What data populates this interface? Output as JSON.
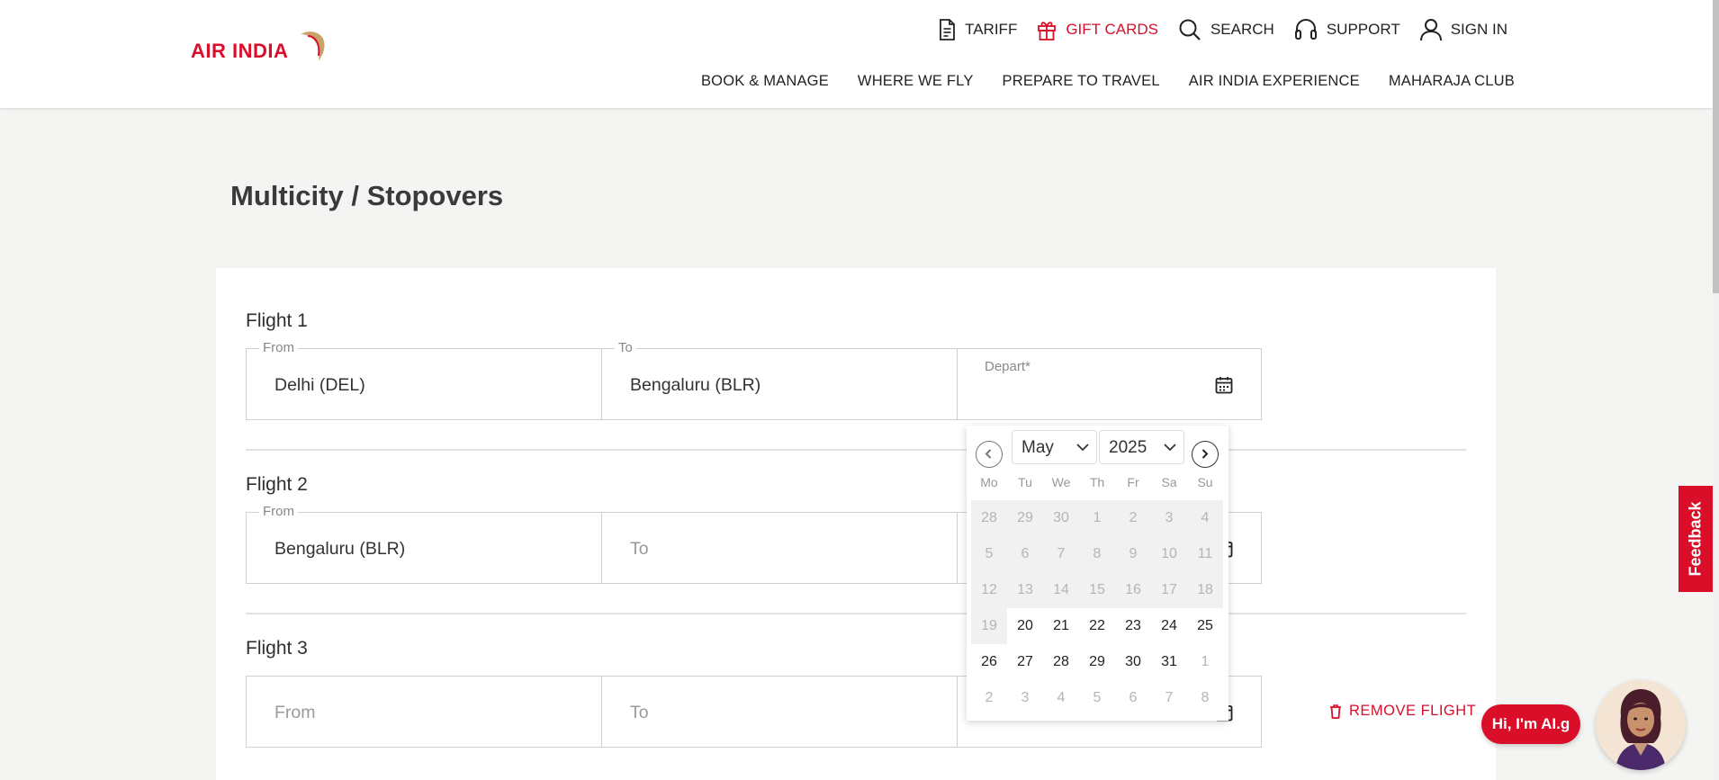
{
  "brand": {
    "logo_text": "AIR INDIA",
    "accent_color": "#da0e29"
  },
  "utility_nav": [
    {
      "label": "TARIFF",
      "icon": "document-icon"
    },
    {
      "label": "GIFT CARDS",
      "icon": "gift-icon"
    },
    {
      "label": "SEARCH",
      "icon": "search-icon"
    },
    {
      "label": "SUPPORT",
      "icon": "headset-icon"
    },
    {
      "label": "SIGN IN",
      "icon": "user-icon"
    }
  ],
  "main_nav": [
    "BOOK & MANAGE",
    "WHERE WE FLY",
    "PREPARE TO TRAVEL",
    "AIR INDIA EXPERIENCE",
    "MAHARAJA CLUB"
  ],
  "page_title": "Multicity / Stopovers",
  "flights": [
    {
      "label": "Flight 1",
      "from_legend": "From",
      "from_value": "Delhi (DEL)",
      "to_legend": "To",
      "to_value": "Bengaluru (BLR)",
      "depart_label": "Depart*"
    },
    {
      "label": "Flight 2",
      "from_legend": "From",
      "from_value": "Bengaluru (BLR)",
      "to_placeholder": "To"
    },
    {
      "label": "Flight 3",
      "from_placeholder": "From",
      "to_placeholder": "To"
    }
  ],
  "remove_flight_label": "REMOVE FLIGHT",
  "datepicker": {
    "month": "May",
    "year": "2025",
    "weekdays": [
      "Mo",
      "Tu",
      "We",
      "Th",
      "Fr",
      "Sa",
      "Su"
    ],
    "weeks": [
      [
        "28",
        "29",
        "30",
        "1",
        "2",
        "3",
        "4"
      ],
      [
        "5",
        "6",
        "7",
        "8",
        "9",
        "10",
        "11"
      ],
      [
        "12",
        "13",
        "14",
        "15",
        "16",
        "17",
        "18"
      ],
      [
        "19",
        "20",
        "21",
        "22",
        "23",
        "24",
        "25"
      ],
      [
        "26",
        "27",
        "28",
        "29",
        "30",
        "31",
        "1"
      ],
      [
        "2",
        "3",
        "4",
        "5",
        "6",
        "7",
        "8"
      ]
    ]
  },
  "feedback_label": "Feedback",
  "assistant": {
    "greeting": "Hi, I'm AI.g"
  }
}
